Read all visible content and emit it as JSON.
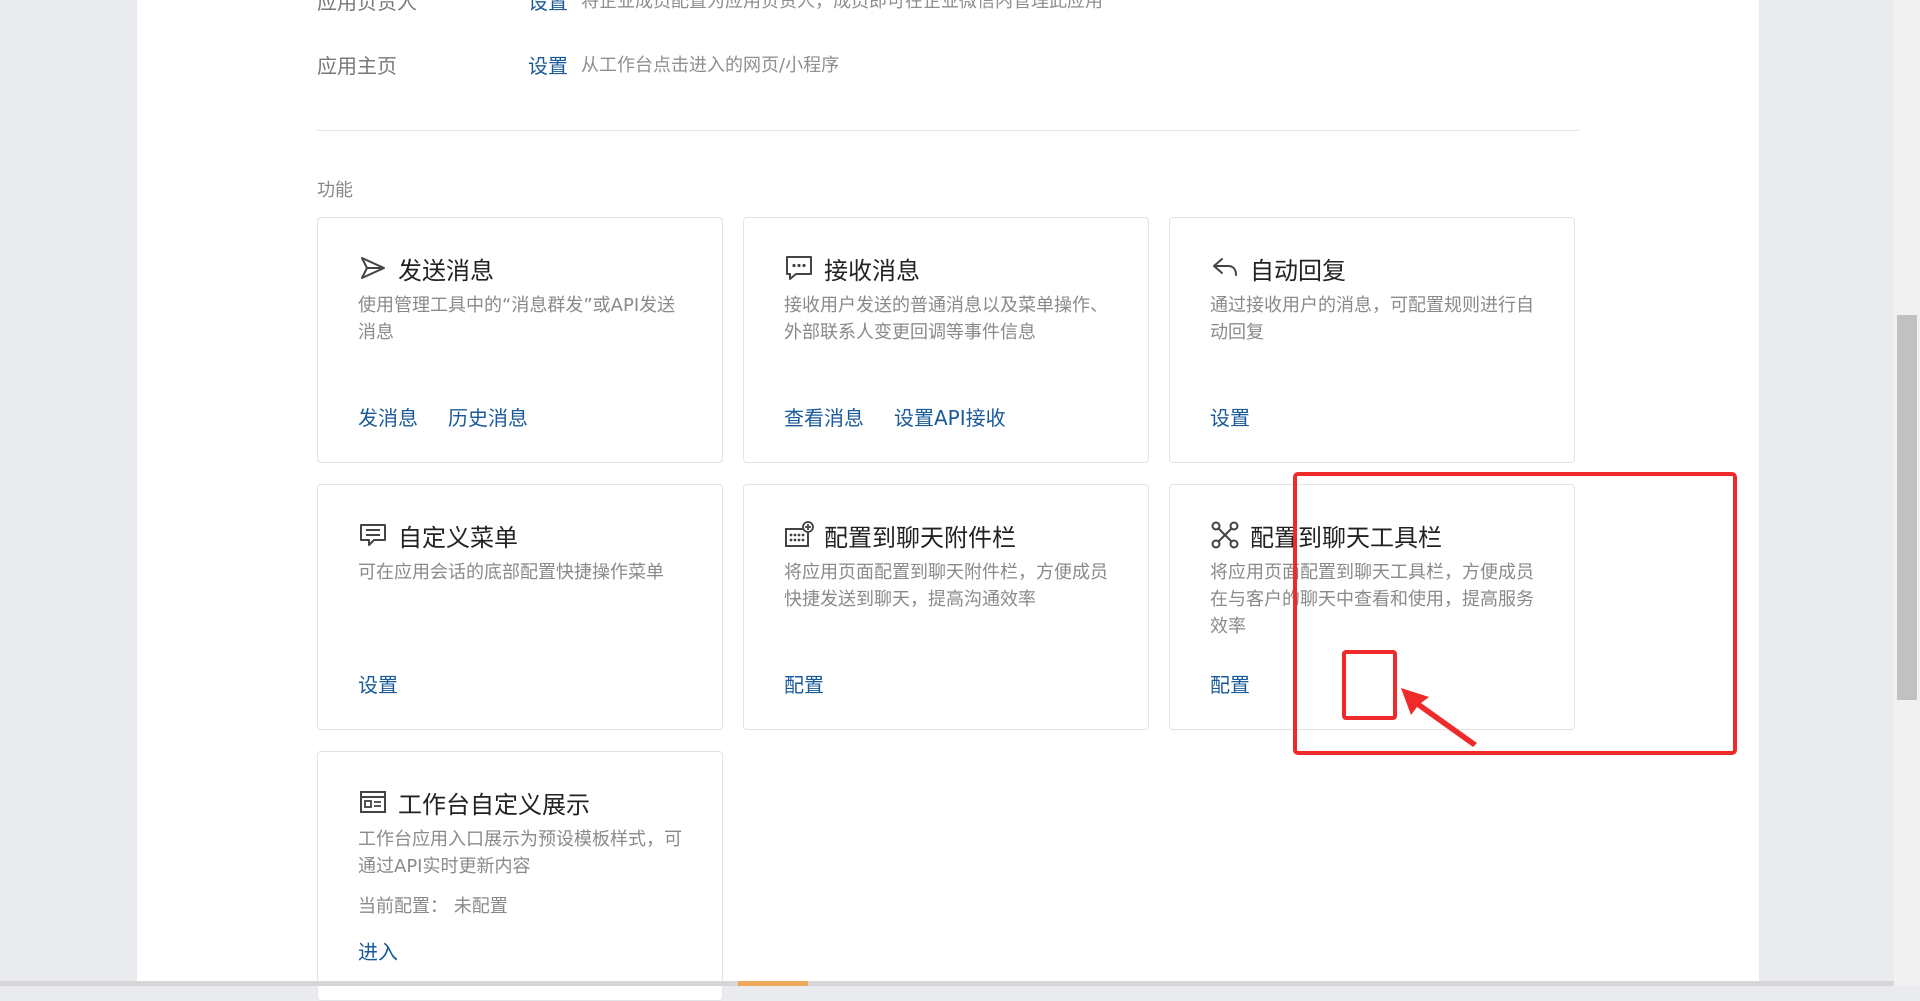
{
  "info_rows": {
    "owner": {
      "label": "应用负责人",
      "link": "设置",
      "desc": "将企业成员配置为应用负责人，成员即可在企业微信内管理此应用"
    },
    "home": {
      "label": "应用主页",
      "link": "设置",
      "desc": "从工作台点击进入的网页/小程序"
    }
  },
  "section_title": "功能",
  "cards": {
    "send": {
      "icon": "send-icon",
      "title": "发送消息",
      "desc": "使用管理工具中的“消息群发”或API发送消息",
      "actions": [
        "发消息",
        "历史消息"
      ]
    },
    "receive": {
      "icon": "chat-bubble-icon",
      "title": "接收消息",
      "desc": "接收用户发送的普通消息以及菜单操作、外部联系人变更回调等事件信息",
      "actions": [
        "查看消息",
        "设置API接收"
      ]
    },
    "reply": {
      "icon": "reply-icon",
      "title": "自动回复",
      "desc": "通过接收用户的消息，可配置规则进行自动回复",
      "actions": [
        "设置"
      ]
    },
    "menu": {
      "icon": "menu-icon",
      "title": "自定义菜单",
      "desc": "可在应用会话的底部配置快捷操作菜单",
      "actions": [
        "设置"
      ]
    },
    "attach": {
      "icon": "keyboard-plus-icon",
      "title": "配置到聊天附件栏",
      "desc": "将应用页面配置到聊天附件栏，方便成员快捷发送到聊天，提高沟通效率",
      "actions": [
        "配置"
      ]
    },
    "toolbar": {
      "icon": "tools-icon",
      "title": "配置到聊天工具栏",
      "desc": "将应用页面配置到聊天工具栏，方便成员在与客户的聊天中查看和使用，提高服务效率",
      "actions": [
        "配置"
      ]
    },
    "workbench": {
      "icon": "display-card-icon",
      "title": "工作台自定义展示",
      "desc": "工作台应用入口展示为预设模板样式，可通过API实时更新内容",
      "extra_label": "当前配置：",
      "extra_value": "未配置",
      "actions": [
        "进入"
      ]
    }
  },
  "colors": {
    "link": "#1a5a9a",
    "annotation": "#ee2a2a"
  }
}
